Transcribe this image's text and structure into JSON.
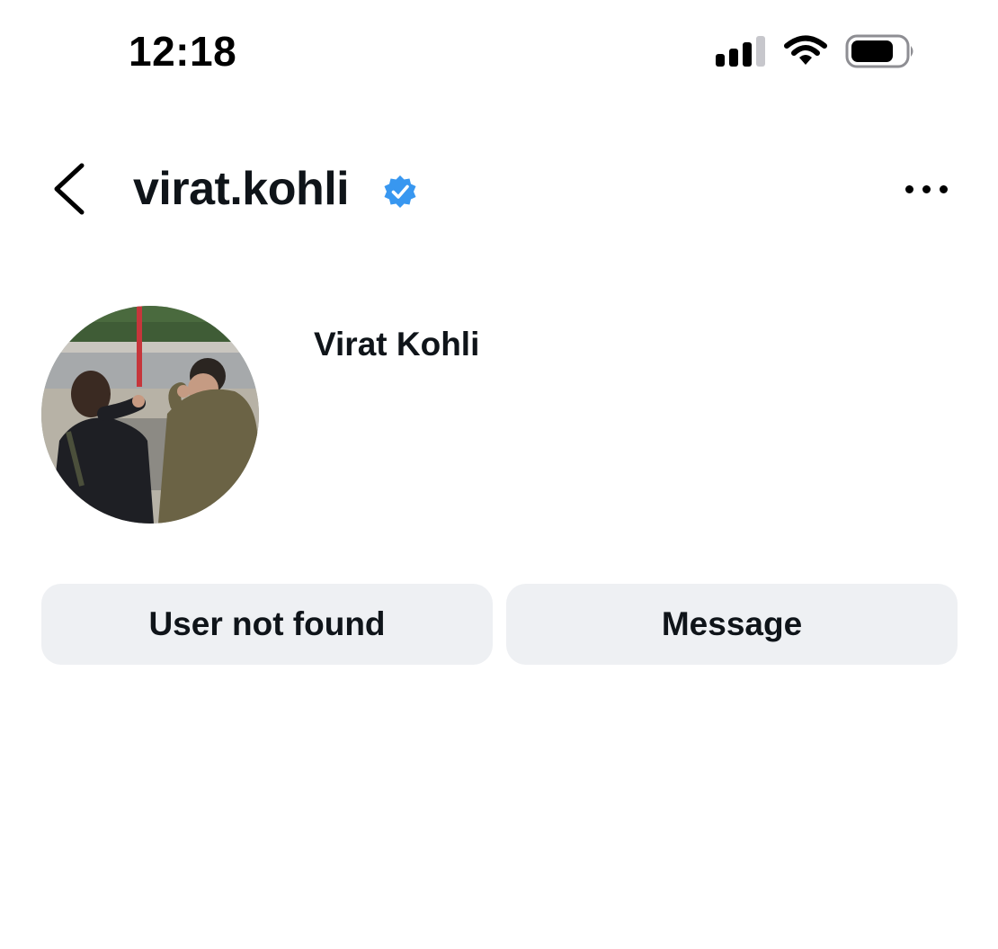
{
  "status_bar": {
    "time": "12:18",
    "signal_icon": "cellular-signal-icon",
    "wifi_icon": "wifi-icon",
    "battery_icon": "battery-icon"
  },
  "header": {
    "back_icon": "chevron-left-icon",
    "username": "virat.kohli",
    "verified_icon": "verified-badge-icon",
    "verified_color": "#3897f0",
    "more_icon": "more-horizontal-icon"
  },
  "profile": {
    "display_name": "Virat Kohli",
    "avatar": "profile-photo"
  },
  "actions": {
    "primary_label": "User not found",
    "secondary_label": "Message",
    "button_bg": "#eef0f3"
  }
}
